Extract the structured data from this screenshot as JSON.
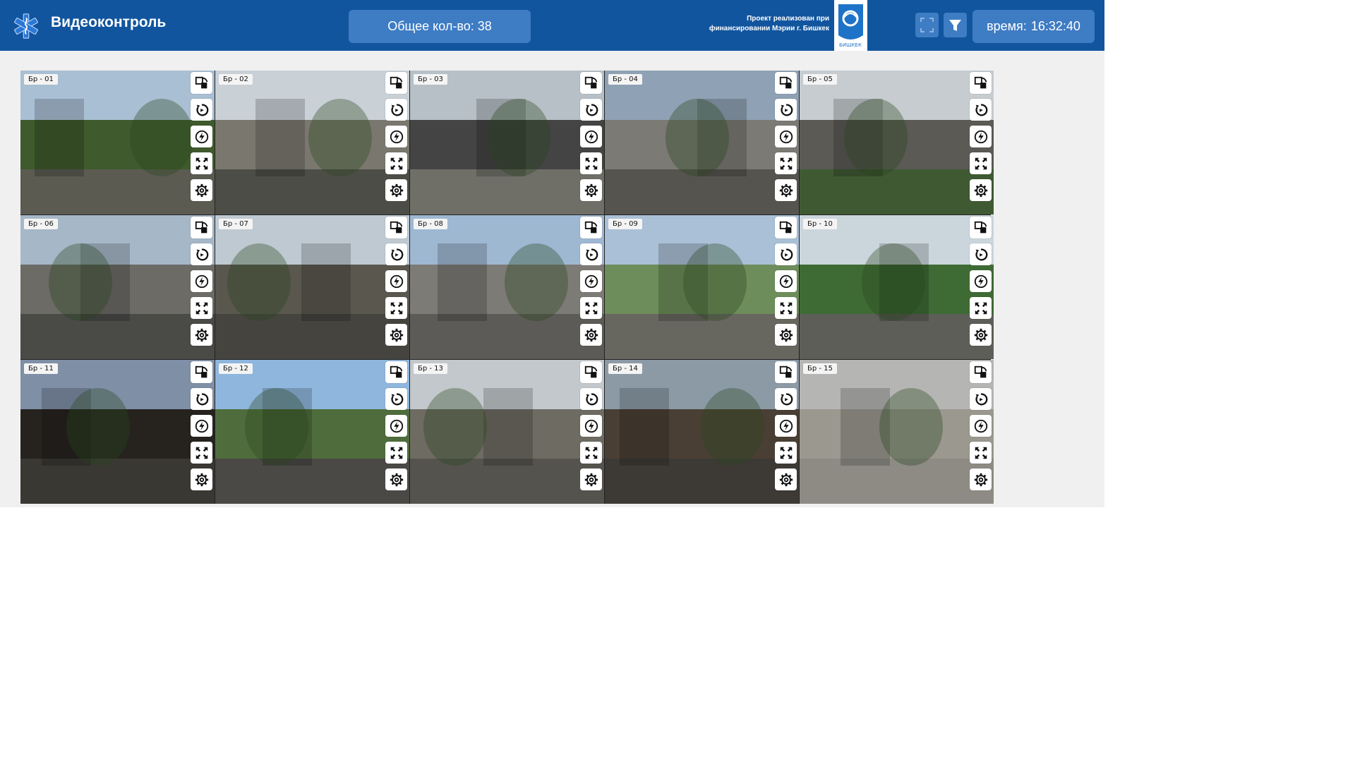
{
  "header": {
    "title": "Видеоконтроль",
    "total_count": "Общее кол-во: 38",
    "project_line1": "Проект реализован при",
    "project_line2": "финансировании Мэрии г. Бишкек",
    "emblem_caption": "БИШКЕК",
    "time_label": "время:",
    "time_value": "16:32:40"
  },
  "icons": {
    "app_logo": "star-of-life-icon",
    "fullscreen": "fullscreen-icon",
    "filter": "filter-icon",
    "camera_tools": [
      "switch-camera-icon",
      "rotate-icon",
      "flash-icon",
      "expand-icon",
      "settings-icon"
    ]
  },
  "colors": {
    "header_bg": "#11559e",
    "pill_bg": "#3e7cc4",
    "page_bg": "#f0f0f0"
  },
  "cameras": [
    {
      "label": "Бр - 01"
    },
    {
      "label": "Бр - 02"
    },
    {
      "label": "Бр - 03"
    },
    {
      "label": "Бр - 04"
    },
    {
      "label": "Бр - 05"
    },
    {
      "label": "Бр - 06"
    },
    {
      "label": "Бр - 07"
    },
    {
      "label": "Бр - 08"
    },
    {
      "label": "Бр - 09"
    },
    {
      "label": "Бр - 10"
    },
    {
      "label": "Бр - 11"
    },
    {
      "label": "Бр - 12"
    },
    {
      "label": "Бр - 13"
    },
    {
      "label": "Бр - 14"
    },
    {
      "label": "Бр - 15"
    }
  ]
}
